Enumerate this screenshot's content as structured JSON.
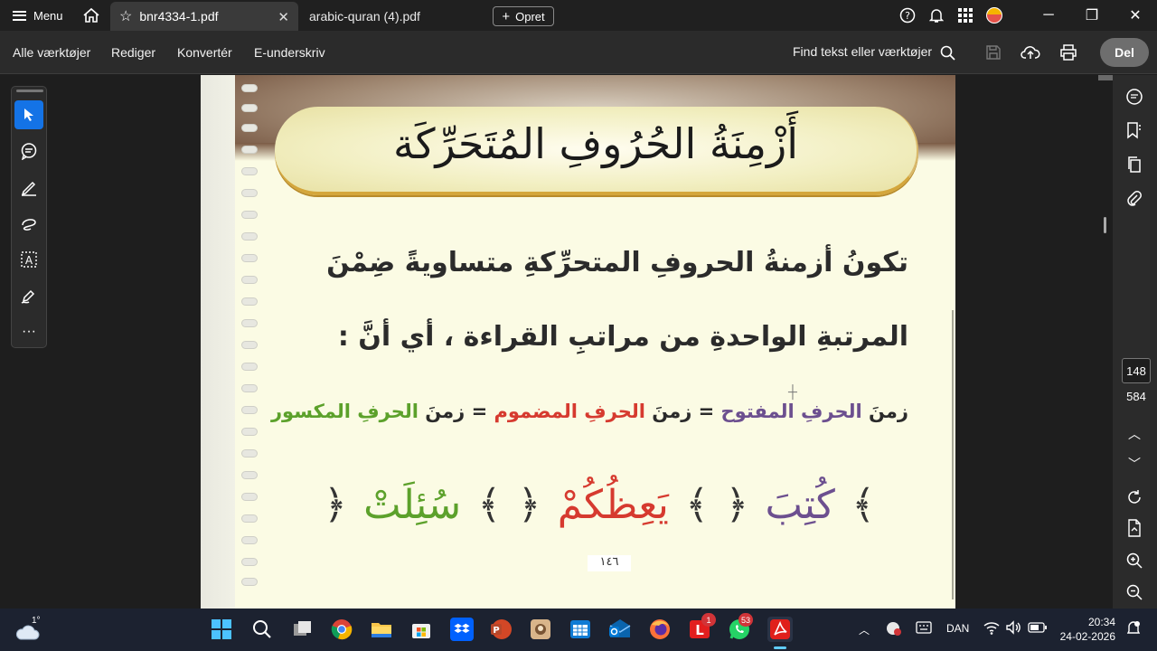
{
  "titlebar": {
    "menu_label": "Menu",
    "tabs": [
      {
        "label": "bnr4334-1.pdf",
        "active": true
      },
      {
        "label": "arabic-quran (4).pdf",
        "active": false
      }
    ],
    "close_glyph": "✕",
    "new_button": "Opret"
  },
  "toolbar": {
    "items": [
      "Alle værktøjer",
      "Rediger",
      "Konvertér",
      "E-underskriv"
    ],
    "find_label": "Find tekst eller værktøjer",
    "share_button": "Del"
  },
  "document": {
    "banner_title": "أَزْمِنَةُ الحُرُوفِ المُتَحَرِّكَة",
    "line1": "تكونُ أزمنةُ الحروفِ المتحرِّكةِ متساويةً ضِمْنَ",
    "line2": "المرتبةِ الواحدةِ من مراتبِ القراءة ، أي أنَّ :",
    "line3": {
      "part1": "زمنَ ",
      "part2": "الحرفِ ",
      "part3": "المفتوح",
      "eq1": " = زمنَ ",
      "part4": "الحرفِ ",
      "part5": "المضموم",
      "eq2": " = زمنَ ",
      "part6": "الحرفِ ",
      "part7": "المكسور"
    },
    "examples": [
      "كُتِبَ",
      "يَعِظُكُمْ",
      "سُئِلَتْ"
    ],
    "ornament_left": "﴿",
    "ornament_right": "﴾",
    "page_number": "١٤٦"
  },
  "page_nav": {
    "current": "148",
    "total": "584"
  },
  "taskbar": {
    "temperature": "1°",
    "language": "DAN",
    "time": "20:34",
    "date": "24-02-2026",
    "badges": {
      "office": "1",
      "whatsapp": "53"
    }
  },
  "colors": {
    "accent": "#1473e6",
    "text_purple": "#6c4f8f",
    "text_red": "#d63a2f",
    "text_green": "#5ca12b"
  }
}
